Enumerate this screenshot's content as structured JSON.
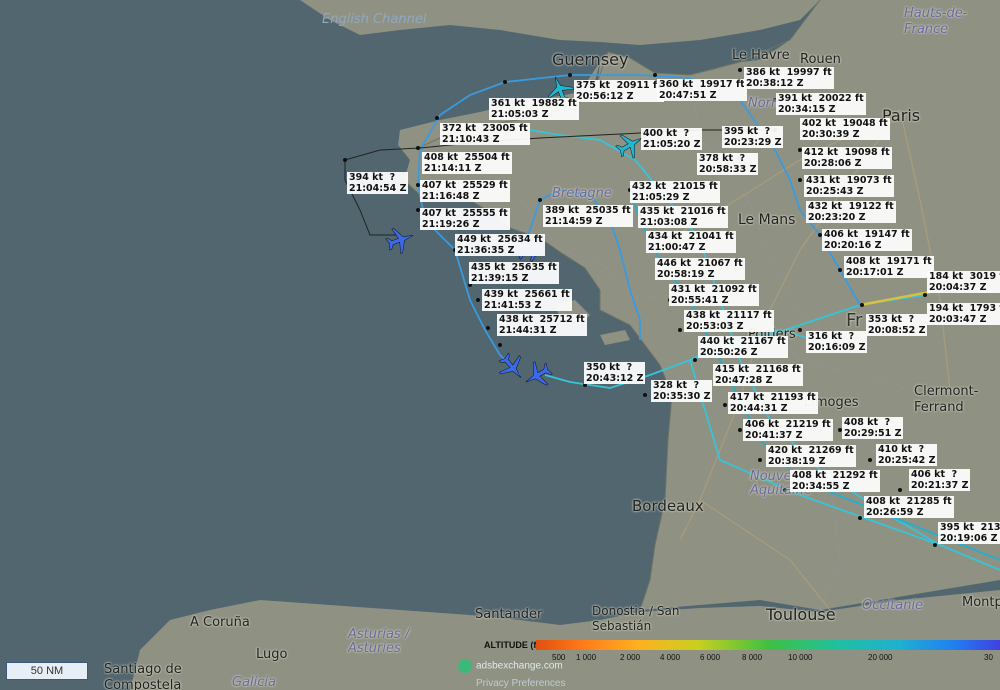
{
  "map": {
    "cities": [
      "Guernsey",
      "Le Havre",
      "Rouen",
      "Paris",
      "Le Mans",
      "Poitiers",
      "Limoges",
      "Clermont-Ferrand",
      "Bordeaux",
      "Toulouse",
      "Santander",
      "A Coruña",
      "Lugo",
      "Santiago de Compostela",
      "Donostia / San Sebastián",
      "Montp"
    ],
    "regions": [
      "Hauts-de-France",
      "Norman",
      "Bretagne",
      "Nouvelle-Aquitaine",
      "Occitanie",
      "Asturias / Asturies",
      "Galicia",
      "Fr"
    ],
    "water": [
      "English Channel"
    ]
  },
  "labels": [
    {
      "speed": "375 kt",
      "alt": "20911 ft",
      "time": "20:56:12 Z"
    },
    {
      "speed": "360 kt",
      "alt": "19917 ft",
      "time": "20:47:51 Z"
    },
    {
      "speed": "386 kt",
      "alt": "19997 ft",
      "time": "20:38:12 Z"
    },
    {
      "speed": "361 kt",
      "alt": "19882 ft",
      "time": "21:05:03 Z"
    },
    {
      "speed": "391 kt",
      "alt": "20022 ft",
      "time": "20:34:15 Z"
    },
    {
      "speed": "372 kt",
      "alt": "23005 ft",
      "time": "21:10:43 Z"
    },
    {
      "speed": "402 kt",
      "alt": "19048 ft",
      "time": "20:30:39 Z"
    },
    {
      "speed": "400 kt",
      "alt": "?",
      "time": "21:05:20 Z"
    },
    {
      "speed": "395 kt",
      "alt": "?",
      "time": "20:23:29 Z"
    },
    {
      "speed": "408 kt",
      "alt": "25504 ft",
      "time": "21:14:11 Z"
    },
    {
      "speed": "412 kt",
      "alt": "19098 ft",
      "time": "20:28:06 Z"
    },
    {
      "speed": "378 kt",
      "alt": "?",
      "time": "20:58:33 Z"
    },
    {
      "speed": "394 kt",
      "alt": "?",
      "time": "21:04:54 Z"
    },
    {
      "speed": "431 kt",
      "alt": "19073 ft",
      "time": "20:25:43 Z"
    },
    {
      "speed": "407 kt",
      "alt": "25529 ft",
      "time": "21:16:48 Z"
    },
    {
      "speed": "432 kt",
      "alt": "21015 ft",
      "time": "21:05:29 Z"
    },
    {
      "speed": "432 kt",
      "alt": "19122 ft",
      "time": "20:23:20 Z"
    },
    {
      "speed": "389 kt",
      "alt": "25035 ft",
      "time": "21:14:59 Z"
    },
    {
      "speed": "407 kt",
      "alt": "25555 ft",
      "time": "21:19:26 Z"
    },
    {
      "speed": "435 kt",
      "alt": "21016 ft",
      "time": "21:03:08 Z"
    },
    {
      "speed": "406 kt",
      "alt": "19147 ft",
      "time": "20:20:16 Z"
    },
    {
      "speed": "449 kt",
      "alt": "25634 ft",
      "time": "21:36:35 Z"
    },
    {
      "speed": "434 kt",
      "alt": "21041 ft",
      "time": "21:00:47 Z"
    },
    {
      "speed": "408 kt",
      "alt": "19171 ft",
      "time": "20:17:01 Z"
    },
    {
      "speed": "446 kt",
      "alt": "21067 ft",
      "time": "20:58:19 Z"
    },
    {
      "speed": "184 kt",
      "alt": "3019 ft",
      "time": "20:04:37 Z"
    },
    {
      "speed": "435 kt",
      "alt": "25635 ft",
      "time": "21:39:15 Z"
    },
    {
      "speed": "431 kt",
      "alt": "21092 ft",
      "time": "20:55:41 Z"
    },
    {
      "speed": "439 kt",
      "alt": "25661 ft",
      "time": "21:41:53 Z"
    },
    {
      "speed": "194 kt",
      "alt": "1793 ft",
      "time": "20:03:47 Z"
    },
    {
      "speed": "438 kt",
      "alt": "21117 ft",
      "time": "20:53:03 Z"
    },
    {
      "speed": "353 kt",
      "alt": "?",
      "time": "20:08:52 Z"
    },
    {
      "speed": "438 kt",
      "alt": "25712 ft",
      "time": "21:44:31 Z"
    },
    {
      "speed": "316 kt",
      "alt": "?",
      "time": "20:16:09 Z"
    },
    {
      "speed": "440 kt",
      "alt": "21167 ft",
      "time": "20:50:26 Z"
    },
    {
      "speed": "350 kt",
      "alt": "?",
      "time": "20:43:12 Z"
    },
    {
      "speed": "415 kt",
      "alt": "21168 ft",
      "time": "20:47:28 Z"
    },
    {
      "speed": "328 kt",
      "alt": "?",
      "time": "20:35:30 Z"
    },
    {
      "speed": "417 kt",
      "alt": "21193 ft",
      "time": "20:44:31 Z"
    },
    {
      "speed": "406 kt",
      "alt": "21219 ft",
      "time": "20:41:37 Z"
    },
    {
      "speed": "408 kt",
      "alt": "?",
      "time": "20:29:51 Z"
    },
    {
      "speed": "420 kt",
      "alt": "21269 ft",
      "time": "20:38:19 Z"
    },
    {
      "speed": "410 kt",
      "alt": "?",
      "time": "20:25:42 Z"
    },
    {
      "speed": "408 kt",
      "alt": "21292 ft",
      "time": "20:34:55 Z"
    },
    {
      "speed": "406 kt",
      "alt": "?",
      "time": "20:21:37 Z"
    },
    {
      "speed": "408 kt",
      "alt": "21285 ft",
      "time": "20:26:59 Z"
    },
    {
      "speed": "395 kt",
      "alt": "2132",
      "time": "20:19:06 Z"
    }
  ],
  "aircraft_count": 6,
  "scale": {
    "label": "50 NM"
  },
  "legend": {
    "title": "ALTITUDE (ft)",
    "ticks": [
      "500",
      "1 000",
      "2 000",
      "4 000",
      "6 000",
      "8 000",
      "10 000",
      "20 000",
      "30"
    ]
  },
  "footer": {
    "brand": "adsbexchange.com",
    "privacy": "Privacy Preferences"
  },
  "colors": {
    "sea": "#52666f",
    "land": "#8f9283",
    "track_cyan": "#35c5d8",
    "track_blue": "#3a9ae0",
    "aircraft_blue": "#3a6ae8",
    "aircraft_cyan": "#20b8d0"
  }
}
